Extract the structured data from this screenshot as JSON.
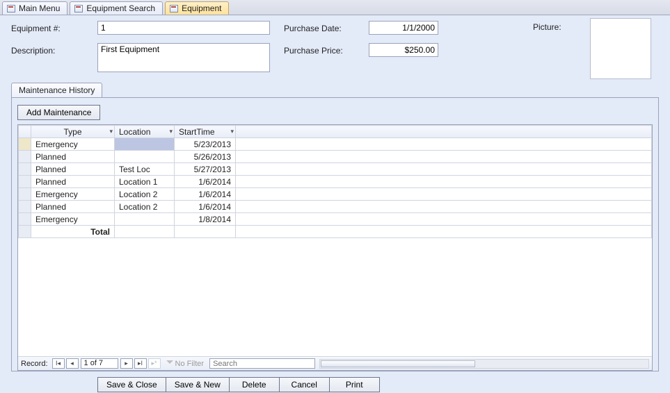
{
  "tabs": [
    {
      "label": "Main Menu",
      "active": false
    },
    {
      "label": "Equipment Search",
      "active": false
    },
    {
      "label": "Equipment",
      "active": true
    }
  ],
  "form": {
    "labels": {
      "equipment_no": "Equipment #:",
      "description": "Description:",
      "purchase_date": "Purchase Date:",
      "purchase_price": "Purchase Price:",
      "picture": "Picture:"
    },
    "values": {
      "equipment_no": "1",
      "description": "First Equipment",
      "purchase_date": "1/1/2000",
      "purchase_price": "$250.00"
    }
  },
  "subtab": {
    "maintenance_history": "Maintenance History"
  },
  "buttons": {
    "add_maintenance": "Add Maintenance",
    "save_close": "Save & Close",
    "save_new": "Save & New",
    "delete": "Delete",
    "cancel": "Cancel",
    "print": "Print"
  },
  "grid": {
    "headers": {
      "type": "Type",
      "location": "Location",
      "starttime": "StartTime"
    },
    "rows": [
      {
        "type": "Emergency",
        "location": "",
        "starttime": "5/23/2013",
        "active": true
      },
      {
        "type": "Planned",
        "location": "",
        "starttime": "5/26/2013"
      },
      {
        "type": "Planned",
        "location": "Test Loc",
        "starttime": "5/27/2013"
      },
      {
        "type": "Planned",
        "location": "Location 1",
        "starttime": "1/6/2014"
      },
      {
        "type": "Emergency",
        "location": "Location 2",
        "starttime": "1/6/2014"
      },
      {
        "type": "Planned",
        "location": "Location 2",
        "starttime": "1/6/2014"
      },
      {
        "type": "Emergency",
        "location": "",
        "starttime": "1/8/2014"
      }
    ],
    "total_label": "Total"
  },
  "recnav": {
    "label": "Record:",
    "position": "1 of 7",
    "nofilter": "No Filter",
    "search_placeholder": "Search"
  }
}
